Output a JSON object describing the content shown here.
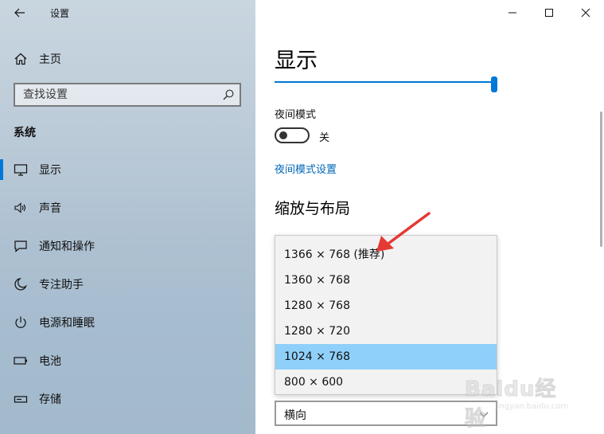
{
  "app": {
    "title": "设置"
  },
  "sidebar": {
    "home_label": "主页",
    "search": {
      "placeholder": "查找设置"
    },
    "section_label": "系统",
    "items": [
      {
        "label": "显示",
        "icon": "monitor-icon",
        "selected": true
      },
      {
        "label": "声音",
        "icon": "speaker-icon",
        "selected": false
      },
      {
        "label": "通知和操作",
        "icon": "notification-icon",
        "selected": false
      },
      {
        "label": "专注助手",
        "icon": "moon-icon",
        "selected": false
      },
      {
        "label": "电源和睡眠",
        "icon": "power-icon",
        "selected": false
      },
      {
        "label": "电池",
        "icon": "battery-icon",
        "selected": false
      },
      {
        "label": "存储",
        "icon": "storage-icon",
        "selected": false
      }
    ]
  },
  "main": {
    "title": "显示",
    "brightness_level": 1.0,
    "night_mode": {
      "label": "夜间模式",
      "state_label": "关",
      "on": false
    },
    "night_mode_link": "夜间模式设置",
    "scale_heading": "缩放与布局",
    "resolution_options": [
      {
        "label": "1366 × 768 (推荐)",
        "selected": false
      },
      {
        "label": "1360 × 768",
        "selected": false
      },
      {
        "label": "1280 × 768",
        "selected": false
      },
      {
        "label": "1280 × 720",
        "selected": false
      },
      {
        "label": "1024 × 768",
        "selected": true
      },
      {
        "label": "800 × 600",
        "selected": false
      }
    ],
    "orientation_value": "横向"
  },
  "watermark": {
    "brand": "Baidu经验",
    "url": "jingyan.baidu.com"
  },
  "colors": {
    "accent": "#0078d7",
    "link": "#0067b8",
    "dropdown_selected": "#8fd0fa",
    "annotation_arrow": "#e53935"
  }
}
